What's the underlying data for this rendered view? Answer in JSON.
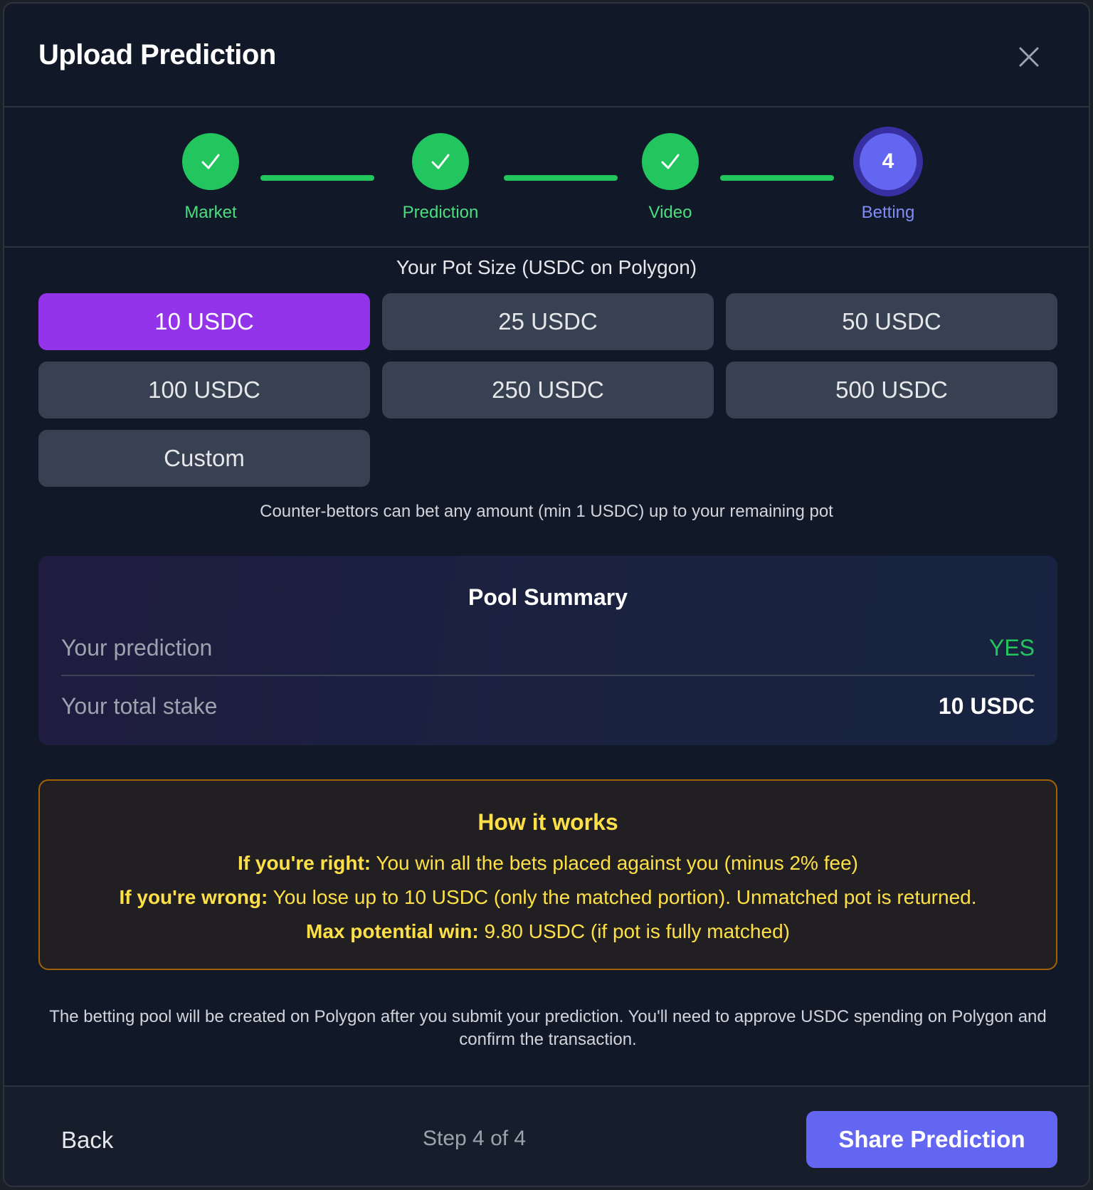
{
  "modal": {
    "title": "Upload Prediction",
    "close_icon": "close-icon"
  },
  "stepper": {
    "steps": [
      {
        "label": "Market",
        "state": "complete",
        "icon": "check-icon"
      },
      {
        "label": "Prediction",
        "state": "complete",
        "icon": "check-icon"
      },
      {
        "label": "Video",
        "state": "complete",
        "icon": "check-icon"
      },
      {
        "label": "Betting",
        "state": "active",
        "number": "4"
      }
    ]
  },
  "pot": {
    "label": "Your Pot Size (USDC on Polygon)",
    "options": [
      "10 USDC",
      "25 USDC",
      "50 USDC",
      "100 USDC",
      "250 USDC",
      "500 USDC",
      "Custom"
    ],
    "selected": "10 USDC",
    "note": "Counter-bettors can bet any amount (min 1 USDC) up to your remaining pot"
  },
  "pool_summary": {
    "title": "Pool Summary",
    "prediction_label": "Your prediction",
    "prediction_value": "YES",
    "stake_label": "Your total stake",
    "stake_value": "10 USDC"
  },
  "how_it_works": {
    "title": "How it works",
    "right_label": "If you're right:",
    "right_text": " You win all the bets placed against you (minus 2% fee)",
    "wrong_label": "If you're wrong:",
    "wrong_text": " You lose up to 10 USDC (only the matched portion). Unmatched pot is returned.",
    "max_label": "Max potential win:",
    "max_text": " 9.80 USDC (if pot is fully matched)"
  },
  "footnote": "The betting pool will be created on Polygon after you submit your prediction. You'll need to approve USDC spending on Polygon and confirm the transaction.",
  "footer": {
    "back_label": "Back",
    "step_text": "Step 4 of 4",
    "share_label": "Share Prediction"
  },
  "colors": {
    "success": "#22c55e",
    "active_step": "#6366f1",
    "selected_amount": "#9333ea",
    "yes": "#22c55e",
    "warning_text": "#fde047",
    "warning_border": "#a16207"
  }
}
